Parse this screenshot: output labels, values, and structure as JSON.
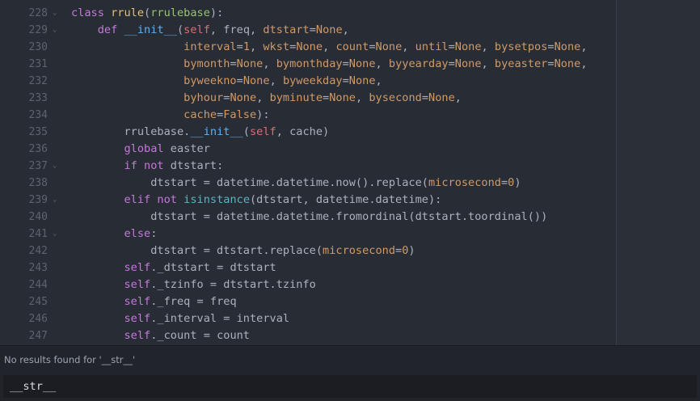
{
  "editor": {
    "lines": [
      {
        "n": "228",
        "fold": true,
        "indent": "",
        "tokens": [
          [
            "kw",
            "class "
          ],
          [
            "cls",
            "rrule"
          ],
          [
            "p",
            "("
          ],
          [
            "inh",
            "rrulebase"
          ],
          [
            "p",
            "):"
          ]
        ]
      },
      {
        "n": "229",
        "fold": true,
        "indent": "    ",
        "tokens": [
          [
            "kw",
            "def "
          ],
          [
            "fn",
            "__init__"
          ],
          [
            "p",
            "("
          ],
          [
            "self",
            "self"
          ],
          [
            "p",
            ", freq, "
          ],
          [
            "param",
            "dtstart"
          ],
          [
            "p",
            "="
          ],
          [
            "param",
            "None"
          ],
          [
            "p",
            ","
          ]
        ]
      },
      {
        "n": "230",
        "fold": false,
        "indent": "                 ",
        "tokens": [
          [
            "param",
            "interval"
          ],
          [
            "p",
            "="
          ],
          [
            "num",
            "1"
          ],
          [
            "p",
            ", "
          ],
          [
            "param",
            "wkst"
          ],
          [
            "p",
            "="
          ],
          [
            "param",
            "None"
          ],
          [
            "p",
            ", "
          ],
          [
            "param",
            "count"
          ],
          [
            "p",
            "="
          ],
          [
            "param",
            "None"
          ],
          [
            "p",
            ", "
          ],
          [
            "param",
            "until"
          ],
          [
            "p",
            "="
          ],
          [
            "param",
            "None"
          ],
          [
            "p",
            ", "
          ],
          [
            "param",
            "bysetpos"
          ],
          [
            "p",
            "="
          ],
          [
            "param",
            "None"
          ],
          [
            "p",
            ","
          ]
        ]
      },
      {
        "n": "231",
        "fold": false,
        "indent": "                 ",
        "tokens": [
          [
            "param",
            "bymonth"
          ],
          [
            "p",
            "="
          ],
          [
            "param",
            "None"
          ],
          [
            "p",
            ", "
          ],
          [
            "param",
            "bymonthday"
          ],
          [
            "p",
            "="
          ],
          [
            "param",
            "None"
          ],
          [
            "p",
            ", "
          ],
          [
            "param",
            "byyearday"
          ],
          [
            "p",
            "="
          ],
          [
            "param",
            "None"
          ],
          [
            "p",
            ", "
          ],
          [
            "param",
            "byeaster"
          ],
          [
            "p",
            "="
          ],
          [
            "param",
            "None"
          ],
          [
            "p",
            ","
          ]
        ]
      },
      {
        "n": "232",
        "fold": false,
        "indent": "                 ",
        "tokens": [
          [
            "param",
            "byweekno"
          ],
          [
            "p",
            "="
          ],
          [
            "param",
            "None"
          ],
          [
            "p",
            ", "
          ],
          [
            "param",
            "byweekday"
          ],
          [
            "p",
            "="
          ],
          [
            "param",
            "None"
          ],
          [
            "p",
            ","
          ]
        ]
      },
      {
        "n": "233",
        "fold": false,
        "indent": "                 ",
        "tokens": [
          [
            "param",
            "byhour"
          ],
          [
            "p",
            "="
          ],
          [
            "param",
            "None"
          ],
          [
            "p",
            ", "
          ],
          [
            "param",
            "byminute"
          ],
          [
            "p",
            "="
          ],
          [
            "param",
            "None"
          ],
          [
            "p",
            ", "
          ],
          [
            "param",
            "bysecond"
          ],
          [
            "p",
            "="
          ],
          [
            "param",
            "None"
          ],
          [
            "p",
            ","
          ]
        ]
      },
      {
        "n": "234",
        "fold": false,
        "indent": "                 ",
        "tokens": [
          [
            "param",
            "cache"
          ],
          [
            "p",
            "="
          ],
          [
            "param",
            "False"
          ],
          [
            "p",
            "):"
          ]
        ]
      },
      {
        "n": "235",
        "fold": false,
        "indent": "        ",
        "tokens": [
          [
            "p",
            "rrulebase."
          ],
          [
            "fn",
            "__init__"
          ],
          [
            "p",
            "("
          ],
          [
            "self",
            "self"
          ],
          [
            "p",
            ", cache)"
          ]
        ]
      },
      {
        "n": "236",
        "fold": false,
        "indent": "        ",
        "tokens": [
          [
            "kw",
            "global "
          ],
          [
            "p",
            "easter"
          ]
        ]
      },
      {
        "n": "237",
        "fold": true,
        "indent": "        ",
        "tokens": [
          [
            "kw",
            "if not "
          ],
          [
            "p",
            "dtstart:"
          ]
        ]
      },
      {
        "n": "238",
        "fold": false,
        "indent": "            ",
        "tokens": [
          [
            "p",
            "dtstart = datetime.datetime.now().replace("
          ],
          [
            "param",
            "microsecond"
          ],
          [
            "p",
            "="
          ],
          [
            "num",
            "0"
          ],
          [
            "p",
            ")"
          ]
        ]
      },
      {
        "n": "239",
        "fold": true,
        "indent": "        ",
        "tokens": [
          [
            "kw",
            "elif not "
          ],
          [
            "builtin",
            "isinstance"
          ],
          [
            "p",
            "(dtstart, datetime.datetime):"
          ]
        ]
      },
      {
        "n": "240",
        "fold": false,
        "indent": "            ",
        "tokens": [
          [
            "p",
            "dtstart = datetime.datetime.fromordinal(dtstart.toordinal())"
          ]
        ]
      },
      {
        "n": "241",
        "fold": true,
        "indent": "        ",
        "tokens": [
          [
            "kw",
            "else"
          ],
          [
            "p",
            ":"
          ]
        ]
      },
      {
        "n": "242",
        "fold": false,
        "indent": "            ",
        "tokens": [
          [
            "p",
            "dtstart = dtstart.replace("
          ],
          [
            "param",
            "microsecond"
          ],
          [
            "p",
            "="
          ],
          [
            "num",
            "0"
          ],
          [
            "p",
            ")"
          ]
        ]
      },
      {
        "n": "243",
        "fold": false,
        "indent": "        ",
        "tokens": [
          [
            "kw",
            "self"
          ],
          [
            "p",
            "._dtstart = dtstart"
          ]
        ]
      },
      {
        "n": "244",
        "fold": false,
        "indent": "        ",
        "tokens": [
          [
            "kw",
            "self"
          ],
          [
            "p",
            "._tzinfo = dtstart.tzinfo"
          ]
        ]
      },
      {
        "n": "245",
        "fold": false,
        "indent": "        ",
        "tokens": [
          [
            "kw",
            "self"
          ],
          [
            "p",
            "._freq = freq"
          ]
        ]
      },
      {
        "n": "246",
        "fold": false,
        "indent": "        ",
        "tokens": [
          [
            "kw",
            "self"
          ],
          [
            "p",
            "._interval = interval"
          ]
        ]
      },
      {
        "n": "247",
        "fold": false,
        "indent": "        ",
        "tokens": [
          [
            "kw",
            "self"
          ],
          [
            "p",
            "._count = count"
          ]
        ]
      }
    ]
  },
  "status": {
    "message": "No results found for '__str__'"
  },
  "find": {
    "value": "__str__"
  }
}
